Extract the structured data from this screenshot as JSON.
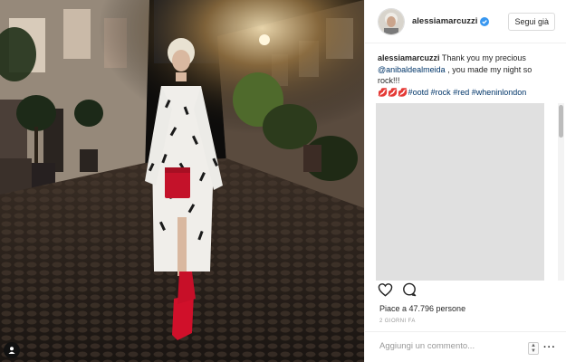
{
  "post": {
    "username": "alessiamarcuzzi",
    "follow_label": "Segui già",
    "caption": {
      "username": "alessiamarcuzzi",
      "text_1": " Thank you my precious ",
      "mention": "@anibaldealmeida",
      "text_2": " , you made my night so rock!!!",
      "emoji": "💋💋💋",
      "hashtags": [
        "#ootd",
        "#rock",
        "#red",
        "#wheninlondon"
      ]
    },
    "likes_text": "Piace a 47.796 persone",
    "time_text": "2 GIORNI FA",
    "comment_placeholder": "Aggiungi un commento..."
  },
  "icons": {
    "verified": "verified-badge-icon",
    "like": "heart-outline-icon",
    "comment": "comment-bubble-icon",
    "tag": "user-tag-icon",
    "more": "more-options-icon"
  },
  "colors": {
    "verified": "#3897f0",
    "link": "#003569",
    "text": "#262626"
  }
}
